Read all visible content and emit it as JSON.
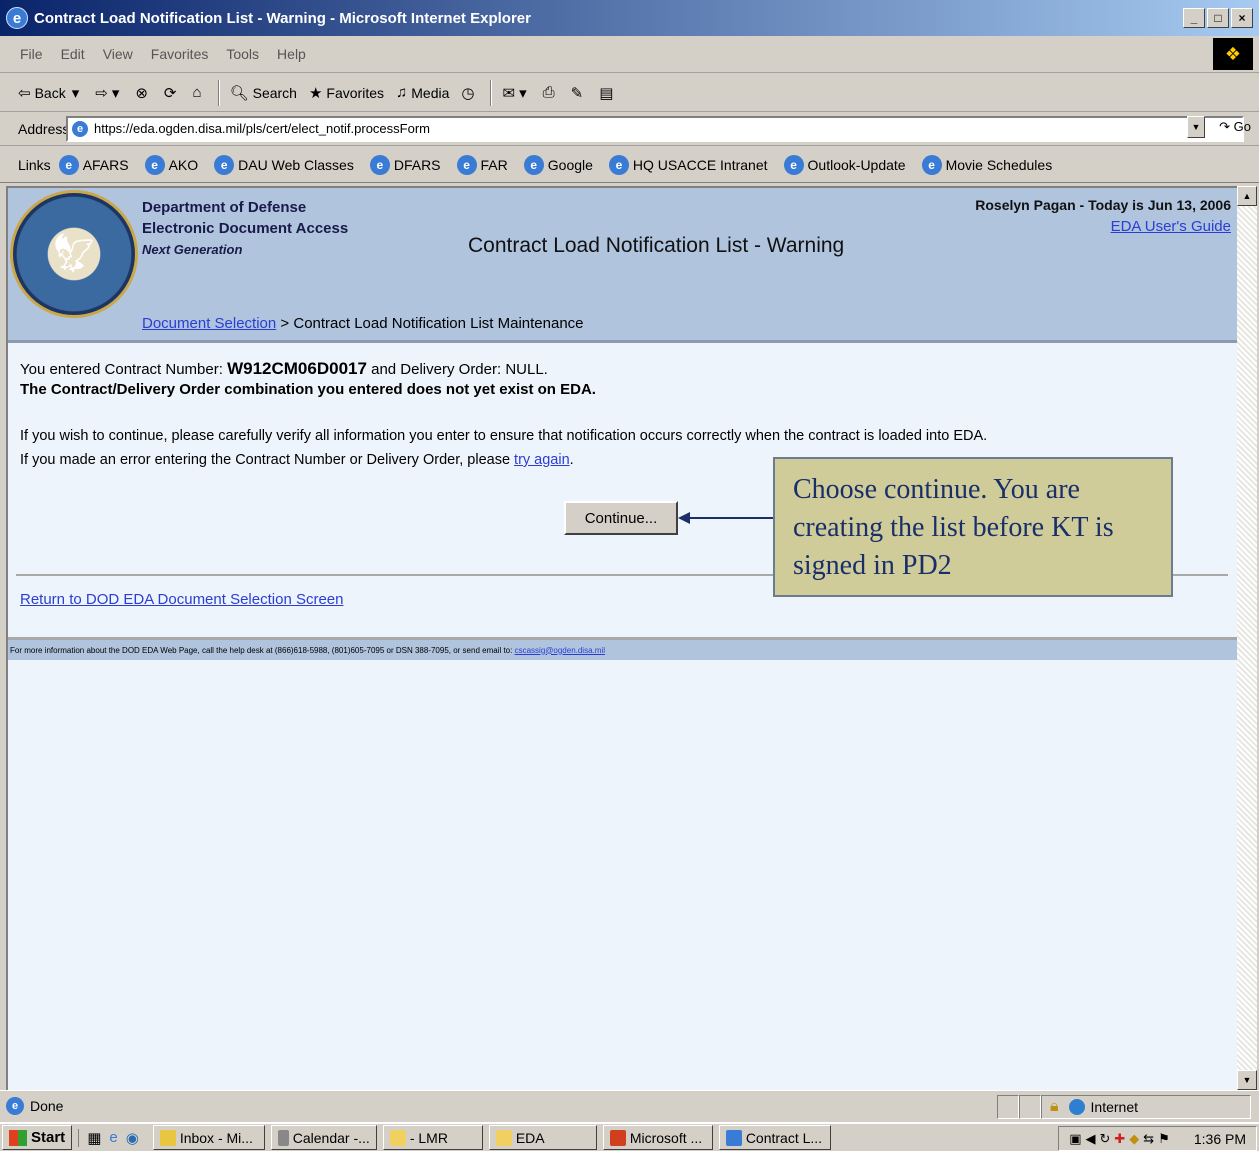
{
  "window": {
    "title": "Contract Load Notification List - Warning - Microsoft Internet Explorer"
  },
  "menu": [
    "File",
    "Edit",
    "View",
    "Favorites",
    "Tools",
    "Help"
  ],
  "toolbar": {
    "back": "Back",
    "search": "Search",
    "favorites": "Favorites",
    "media": "Media"
  },
  "address": {
    "label": "Address",
    "url": "https://eda.ogden.disa.mil/pls/cert/elect_notif.processForm",
    "go": "Go"
  },
  "links": {
    "label": "Links",
    "items": [
      "AFARS",
      "AKO",
      "DAU Web Classes",
      "DFARS",
      "FAR",
      "Google",
      "HQ USACCE Intranet",
      "Outlook-Update",
      "Movie Schedules"
    ]
  },
  "header": {
    "dept_line1": "Department of Defense",
    "dept_line2": "Electronic Document Access",
    "dept_line3": "Next Generation",
    "page_title": "Contract Load Notification List - Warning",
    "user_date": "Roselyn Pagan - Today is Jun 13, 2006",
    "guide_link": "EDA User's Guide"
  },
  "breadcrumb": {
    "link": "Document Selection",
    "separator": ">",
    "current": "Contract Load Notification List Maintenance"
  },
  "message": {
    "prefix": "You entered Contract Number:",
    "contract_number": "W912CM06D0017",
    "middle": "and Delivery Order: NULL.",
    "warning": "The Contract/Delivery Order combination you entered does not yet exist on EDA.",
    "info1": "If you wish to continue, please carefully verify all information you enter to ensure that notification occurs correctly when the contract is loaded into EDA.",
    "info2_prefix": "If you made an error entering the Contract Number or Delivery Order, please",
    "info2_link": "try again",
    "info2_suffix": "."
  },
  "continue_button": "Continue...",
  "return_link": "Return to DOD EDA Document Selection Screen",
  "footer": {
    "text": "For more information about the DOD EDA Web Page, call the help desk at (866)618-5988, (801)605-7095 or DSN 388-7095, or send email to:",
    "email": "cscassig@ogden.disa.mil"
  },
  "callout": {
    "text": "Choose continue.  You are creating the list before KT is signed in PD2"
  },
  "status": {
    "text": "Done",
    "zone": "Internet"
  },
  "taskbar": {
    "start": "Start",
    "tasks": [
      "Inbox - Mi...",
      "Calendar -...",
      "- LMR",
      "EDA",
      "Microsoft ...",
      "Contract L..."
    ],
    "clock": "1:36 PM"
  },
  "colors": {
    "header_bg": "#b0c4de",
    "link": "#2a3ed4",
    "callout_bg": "#cfcc99",
    "callout_text": "#1a2f6a"
  }
}
